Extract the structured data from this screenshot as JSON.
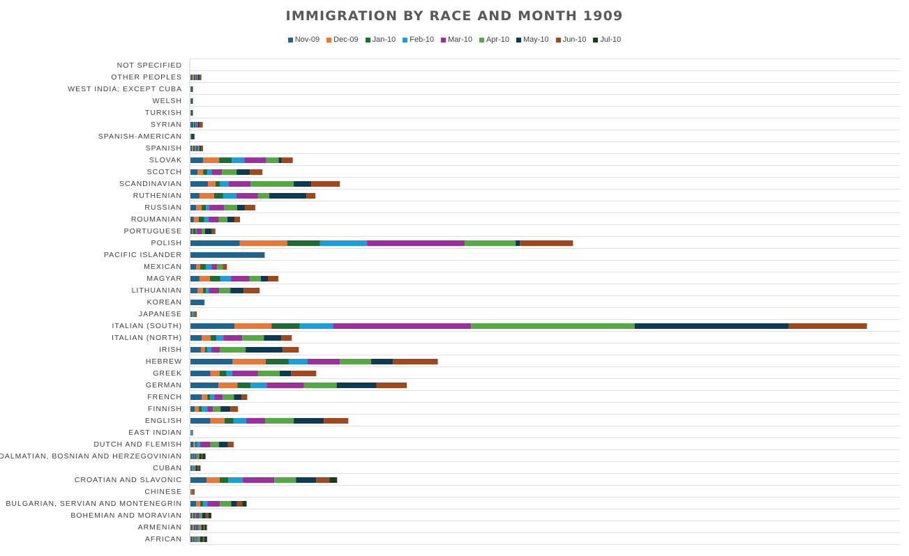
{
  "chart_data": {
    "type": "bar",
    "orientation": "horizontal",
    "stacked": true,
    "title": "IMMIGRATION BY RACE AND MONTH 1909",
    "legend_position": "top",
    "grid": true,
    "xlim": [
      0,
      3540
    ],
    "categories": [
      "NOT SPECIFIED",
      "OTHER PEOPLES",
      "WEST INDIA; EXCEPT CUBA",
      "WELSH",
      "TURKISH",
      "SYRIAN",
      "SPANISH-AMERICAN",
      "SPANISH",
      "SLOVAK",
      "SCOTCH",
      "SCANDINAVIAN",
      "RUTHENIAN",
      "RUSSIAN",
      "ROUMANIAN",
      "PORTUGUESE",
      "POLISH",
      "PACIFIC ISLANDER",
      "MEXICAN",
      "MAGYAR",
      "LITHUANIAN",
      "KOREAN",
      "JAPANESE",
      "ITALIAN (SOUTH)",
      "ITALIAN (NORTH)",
      "IRISH",
      "HEBREW",
      "GREEK",
      "GERMAN",
      "FRENCH",
      "FINNISH",
      "ENGLISH",
      "EAST INDIAN",
      "DUTCH AND FLEMISH",
      "DALMATIAN, BOSNIAN AND HERZEGOVINIAN",
      "CUBAN",
      "CROATIAN AND SLAVONIC",
      "CHINESE",
      "BULGARIAN, SERVIAN AND MONTENEGRIN",
      "BOHEMIAN AND MORAVIAN",
      "ARMENIAN",
      "AFRICAN"
    ],
    "series": [
      {
        "name": "Nov-09",
        "color": "#1f6391",
        "values": [
          0,
          10,
          3,
          3,
          3,
          14,
          3,
          7,
          63,
          35,
          87,
          45,
          28,
          17,
          10,
          245,
          370,
          28,
          45,
          35,
          70,
          7,
          220,
          56,
          52,
          210,
          100,
          140,
          56,
          21,
          100,
          3,
          14,
          7,
          7,
          80,
          3,
          28,
          7,
          10,
          10
        ]
      },
      {
        "name": "Dec-09",
        "color": "#e8773a",
        "values": [
          0,
          7,
          0,
          0,
          0,
          3,
          0,
          7,
          80,
          28,
          38,
          73,
          28,
          24,
          3,
          237,
          0,
          21,
          52,
          28,
          0,
          3,
          185,
          45,
          21,
          165,
          45,
          94,
          28,
          21,
          70,
          0,
          10,
          3,
          3,
          66,
          3,
          21,
          7,
          7,
          3
        ]
      },
      {
        "name": "Jan-10",
        "color": "#1e6b33",
        "values": [
          0,
          7,
          3,
          3,
          3,
          7,
          3,
          7,
          63,
          21,
          21,
          45,
          21,
          28,
          14,
          164,
          0,
          28,
          52,
          14,
          0,
          3,
          140,
          28,
          10,
          115,
          35,
          66,
          14,
          14,
          45,
          0,
          7,
          7,
          3,
          42,
          3,
          14,
          7,
          7,
          7
        ]
      },
      {
        "name": "Feb-10",
        "color": "#1a9dd8",
        "values": [
          0,
          3,
          0,
          0,
          0,
          3,
          0,
          7,
          63,
          21,
          45,
          66,
          17,
          21,
          3,
          234,
          0,
          28,
          52,
          14,
          0,
          3,
          165,
          35,
          21,
          94,
          28,
          80,
          21,
          28,
          63,
          3,
          17,
          3,
          3,
          73,
          0,
          21,
          7,
          3,
          7
        ]
      },
      {
        "name": "Mar-10",
        "color": "#9b2f9b",
        "values": [
          0,
          7,
          0,
          0,
          0,
          7,
          0,
          10,
          108,
          52,
          108,
          108,
          73,
          52,
          28,
          487,
          0,
          28,
          94,
          52,
          0,
          3,
          689,
          94,
          42,
          160,
          129,
          185,
          42,
          28,
          94,
          0,
          52,
          10,
          3,
          157,
          3,
          63,
          17,
          14,
          7
        ]
      },
      {
        "name": "Apr-10",
        "color": "#57a845",
        "values": [
          0,
          3,
          0,
          0,
          0,
          3,
          0,
          7,
          63,
          73,
          216,
          56,
          66,
          42,
          14,
          254,
          0,
          28,
          56,
          56,
          0,
          3,
          815,
          108,
          129,
          157,
          108,
          164,
          56,
          38,
          143,
          3,
          42,
          14,
          7,
          108,
          3,
          56,
          14,
          14,
          14
        ]
      },
      {
        "name": "May-10",
        "color": "#0d3a50",
        "values": [
          0,
          7,
          3,
          3,
          3,
          7,
          7,
          7,
          14,
          66,
          87,
          185,
          38,
          35,
          35,
          21,
          0,
          0,
          35,
          66,
          0,
          3,
          769,
          87,
          185,
          108,
          56,
          199,
          38,
          49,
          150,
          3,
          45,
          10,
          10,
          101,
          3,
          28,
          17,
          10,
          14
        ]
      },
      {
        "name": "Jun-10",
        "color": "#a0481b",
        "values": [
          0,
          7,
          0,
          0,
          0,
          14,
          0,
          7,
          56,
          63,
          143,
          45,
          52,
          28,
          14,
          265,
          0,
          21,
          52,
          80,
          0,
          3,
          389,
          52,
          80,
          224,
          126,
          150,
          28,
          38,
          122,
          0,
          28,
          7,
          7,
          66,
          3,
          28,
          14,
          7,
          7
        ]
      },
      {
        "name": "Jul-10",
        "color": "#173f1f",
        "values": [
          0,
          3,
          3,
          3,
          3,
          3,
          7,
          3,
          0,
          0,
          0,
          0,
          0,
          0,
          3,
          0,
          0,
          0,
          0,
          0,
          0,
          3,
          0,
          0,
          0,
          0,
          0,
          0,
          0,
          0,
          0,
          0,
          0,
          14,
          7,
          38,
          0,
          21,
          14,
          10,
          14
        ]
      }
    ]
  }
}
